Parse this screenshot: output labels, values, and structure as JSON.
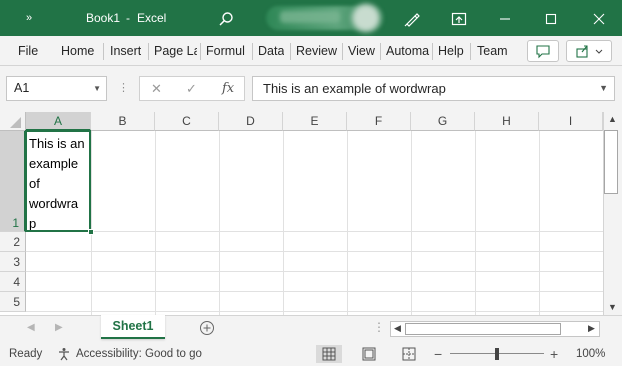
{
  "titlebar": {
    "expand_glyph": "»",
    "doc_title": "Book1",
    "separator": "-",
    "app_name": "Excel",
    "icons": [
      "search-icon",
      "pen-icon",
      "ribbon-display-icon",
      "minimize-icon",
      "maximize-icon",
      "close-icon"
    ]
  },
  "ribbon": {
    "tabs": [
      "File",
      "Home",
      "Insert",
      "Page La",
      "Formul",
      "Data",
      "Review",
      "View",
      "Automa",
      "Help",
      "Team"
    ]
  },
  "formula_bar": {
    "name_box": "A1",
    "formula": "This is an example of wordwrap"
  },
  "grid": {
    "columns": [
      "A",
      "B",
      "C",
      "D",
      "E",
      "F",
      "G",
      "H",
      "I"
    ],
    "rows": [
      "1",
      "2",
      "3",
      "4",
      "5"
    ],
    "cells": {
      "A1": "This is an\nexample\nof\nwordwra\np"
    },
    "selected_cell": "A1",
    "selection_color": "#217346"
  },
  "sheets": {
    "tabs": [
      "Sheet1"
    ],
    "active": "Sheet1"
  },
  "status": {
    "mode": "Ready",
    "accessibility": "Accessibility: Good to go",
    "zoom": "100%",
    "zoom_fraction": 0.5
  },
  "colors": {
    "accent": "#217346",
    "chrome": "#f3f3f3"
  }
}
